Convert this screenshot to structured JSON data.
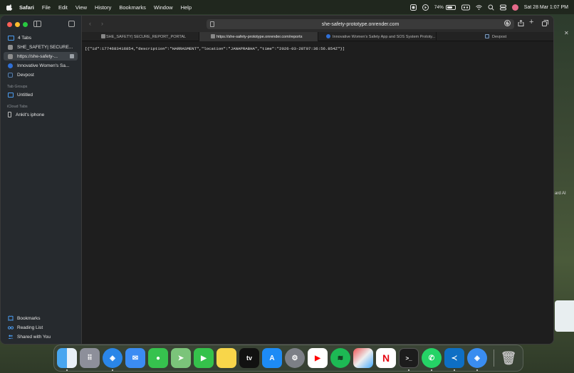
{
  "menubar": {
    "app": "Safari",
    "items": [
      "File",
      "Edit",
      "View",
      "History",
      "Bookmarks",
      "Window",
      "Help"
    ],
    "battery_level": 0.74,
    "battery": "74%",
    "datetime": "Sat 28 Mar  1:07 PM"
  },
  "sidebar": {
    "tabs_group": "4 Tabs",
    "tabs": [
      {
        "label": "SHE_SAFETY| SECURE...",
        "icon": "page-icon"
      },
      {
        "label": "https://she-safety-...",
        "icon": "page-icon",
        "active": true
      },
      {
        "label": "Innovative Women's Sa...",
        "icon": "blue-circle-icon"
      },
      {
        "label": "Devpost",
        "icon": "devpost-icon"
      }
    ],
    "tab_groups_heading": "Tab Groups",
    "tab_groups": [
      {
        "label": "Untitled"
      }
    ],
    "icloud_heading": "iCloud Tabs",
    "icloud_devices": [
      {
        "label": "Ankit's iphone"
      }
    ],
    "bottom": {
      "bookmarks": "Bookmarks",
      "reading_list": "Reading List",
      "shared": "Shared with You"
    }
  },
  "toolbar": {
    "address": "she-safety-prototype.onrender.com"
  },
  "tabstrip": [
    {
      "label": "SHE_SAFETY| SECURE_REPORT_PORTAL",
      "active": false
    },
    {
      "label": "https://she-safety-prototype.onrender.com/reports",
      "active": true
    },
    {
      "label": "Innovative Women's Safety App and SOS System Prototy...",
      "active": false
    },
    {
      "label": "Devpost",
      "active": false
    }
  ],
  "page": {
    "json_text": "[{\"id\":1774683416854,\"description\":\"HARRASMENT\",\"location\":\"JANAPRABHA\",\"time\":\"2026-03-28T07:36:56.854Z\"}]"
  },
  "background_window": {
    "text": "ard AI"
  },
  "dock": {
    "apps": [
      "finder-icon",
      "launchpad-icon",
      "safari-icon",
      "mail-icon",
      "messages-icon",
      "maps-icon",
      "facetime-icon",
      "notes-icon",
      "appletv-icon",
      "appstore-icon",
      "settings-icon",
      "youtube-icon",
      "spotify-icon",
      "gallery-icon",
      "netflix-icon",
      "terminal-icon",
      "whatsapp-icon",
      "vscode-icon",
      "safari-downloads-icon",
      "trash-icon"
    ],
    "appletv_label": "tv"
  }
}
